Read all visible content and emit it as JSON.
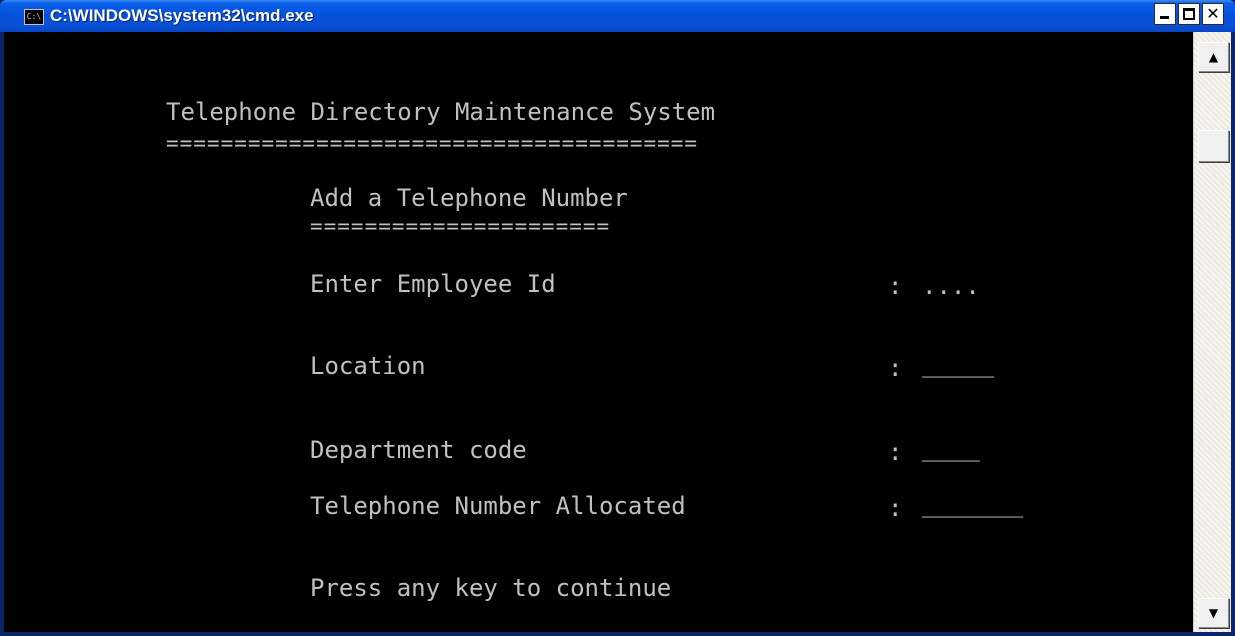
{
  "window": {
    "title": "C:\\WINDOWS\\system32\\cmd.exe",
    "icon": "console-icon",
    "icon_text": "C:\\",
    "controls": {
      "minimize": "minimize-icon",
      "maximize": "maximize-icon",
      "close": "close-icon",
      "close_glyph": "✕"
    }
  },
  "console": {
    "heading": "Telephone Directory Maintenance System",
    "heading_rule": "=======================================",
    "subheading": "Add a Telephone Number",
    "subheading_rule": "======================",
    "fields": [
      {
        "label": "Enter Employee Id",
        "separator": ":",
        "value": "...."
      },
      {
        "label": "Location",
        "separator": ":",
        "value": "_____"
      },
      {
        "label": "Department code",
        "separator": ":",
        "value": "____"
      },
      {
        "label": "Telephone Number Allocated",
        "separator": ":",
        "value": "_______"
      }
    ],
    "prompt": "Press any key to continue",
    "text_color": "#c0c0c0",
    "background_color": "#000000"
  },
  "scrollbar": {
    "up_arrow": "▲",
    "down_arrow": "▼"
  }
}
